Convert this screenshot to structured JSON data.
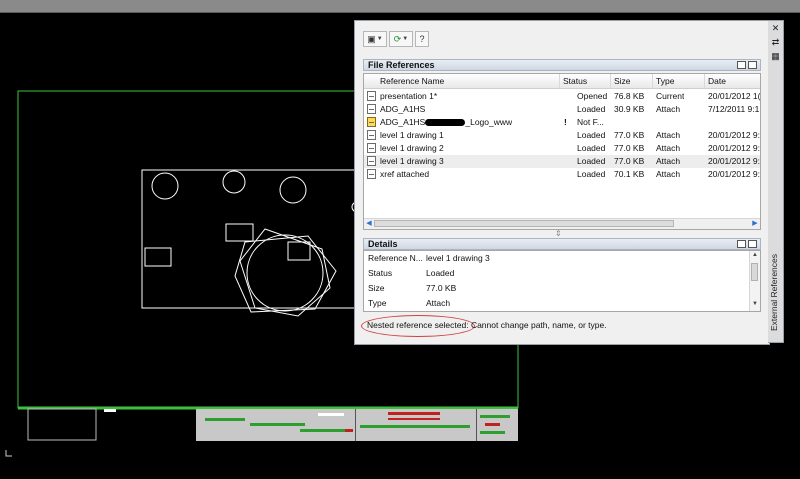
{
  "palette": {
    "file_refs_title": "File References",
    "columns": [
      "Reference Name",
      "Status",
      "Size",
      "Type",
      "Date"
    ],
    "files": [
      {
        "name": "presentation 1*",
        "status": "Opened",
        "size": "76.8 KB",
        "type": "Current",
        "date": "20/01/2012 1(",
        "warn": false
      },
      {
        "name": "ADG_A1HS",
        "status": "Loaded",
        "size": "30.9 KB",
        "type": "Attach",
        "date": "7/12/2011 9:1",
        "warn": false
      },
      {
        "name": "ADG_A1HS",
        "name_suffix": "_Logo_www",
        "status": "Not F...",
        "size": "",
        "type": "",
        "date": "",
        "warn": true
      },
      {
        "name": "level 1 drawing 1",
        "status": "Loaded",
        "size": "77.0 KB",
        "type": "Attach",
        "date": "20/01/2012 9:",
        "warn": false
      },
      {
        "name": "level 1 drawing 2",
        "status": "Loaded",
        "size": "77.0 KB",
        "type": "Attach",
        "date": "20/01/2012 9:",
        "warn": false
      },
      {
        "name": "level 1 drawing 3",
        "status": "Loaded",
        "size": "77.0 KB",
        "type": "Attach",
        "date": "20/01/2012 9:",
        "warn": false,
        "selected": true
      },
      {
        "name": "xref attached",
        "status": "Loaded",
        "size": "70.1 KB",
        "type": "Attach",
        "date": "20/01/2012 9:",
        "warn": false
      }
    ],
    "details_title": "Details",
    "details": [
      {
        "label": "Reference N...",
        "value": "level 1 drawing 3"
      },
      {
        "label": "Status",
        "value": "Loaded"
      },
      {
        "label": "Size",
        "value": "77.0 KB"
      },
      {
        "label": "Type",
        "value": "Attach"
      }
    ],
    "message": "Nested reference selected: Cannot change path, name, or type.",
    "side_title": "External References",
    "help_label": "?"
  },
  "colors": {
    "drawing_green": "#3fbf3f",
    "geometry_white": "#ffffff",
    "annotation_red": "#d04040"
  },
  "icons": [
    "attach-dwg-icon",
    "refresh-icon",
    "help-icon",
    "list-view-icon",
    "tree-view-icon",
    "close-icon",
    "auto-hide-icon",
    "properties-icon"
  ]
}
